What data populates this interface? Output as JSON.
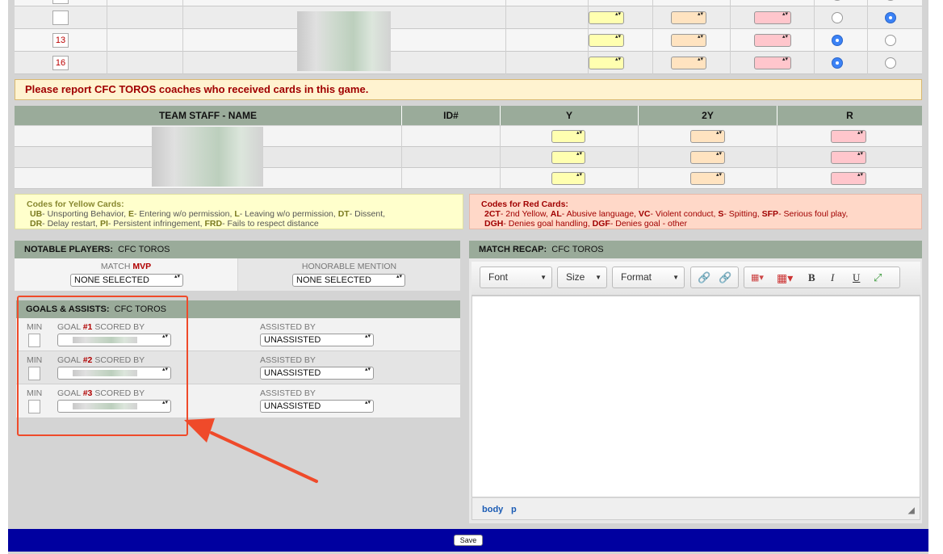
{
  "players": {
    "rows": [
      {
        "number": "",
        "y": "",
        "y2": "",
        "r": "",
        "radio_a": false,
        "radio_b": true
      },
      {
        "number": "13",
        "y": "",
        "y2": "",
        "r": "",
        "radio_a": true,
        "radio_b": false
      },
      {
        "number": "16",
        "y": "",
        "y2": "",
        "r": "",
        "radio_a": true,
        "radio_b": false
      }
    ]
  },
  "notice": {
    "text": "Please report CFC TOROS coaches who received cards in this game."
  },
  "staff": {
    "headers": {
      "name": "TEAM STAFF - NAME",
      "id": "ID#",
      "y": "Y",
      "y2": "2Y",
      "r": "R"
    },
    "rows": [
      {},
      {},
      {}
    ]
  },
  "yellow_codes": {
    "title": "Codes for Yellow Cards:",
    "line1": [
      {
        "code": "UB",
        "desc": "- Unsporting Behavior, "
      },
      {
        "code": "E",
        "desc": "- Entering w/o permission, "
      },
      {
        "code": "L",
        "desc": "- Leaving w/o permission, "
      },
      {
        "code": "DT",
        "desc": "- Dissent,"
      }
    ],
    "line2": [
      {
        "code": "DR",
        "desc": "- Delay restart, "
      },
      {
        "code": "PI",
        "desc": "- Persistent infringement, "
      },
      {
        "code": "FRD",
        "desc": "- Fails to respect distance"
      }
    ]
  },
  "red_codes": {
    "title": "Codes for Red Cards:",
    "line1": [
      {
        "code": "2CT",
        "desc": "- 2nd Yellow, "
      },
      {
        "code": "AL",
        "desc": "- Abusive language, "
      },
      {
        "code": "VC",
        "desc": "- Violent conduct, "
      },
      {
        "code": "S",
        "desc": "- Spitting, "
      },
      {
        "code": "SFP",
        "desc": "- Serious foul play,"
      }
    ],
    "line2": [
      {
        "code": "DGH",
        "desc": "- Denies goal handling, "
      },
      {
        "code": "DGF",
        "desc": "- Denies goal - other"
      }
    ]
  },
  "notable": {
    "label": "NOTABLE PLAYERS:",
    "team": "CFC TOROS",
    "mvp_prefix": "MATCH ",
    "mvp_word": "MVP",
    "mvp_value": "NONE SELECTED",
    "honorable_label": "HONORABLE MENTION",
    "honorable_value": "NONE SELECTED"
  },
  "goals": {
    "label": "GOALS & ASSISTS:",
    "team": "CFC TOROS",
    "rows": [
      {
        "min_label": "MIN",
        "goal_prefix": "GOAL ",
        "goal_num": "#1",
        "goal_suffix": " SCORED BY",
        "assist_label": "ASSISTED BY",
        "assist_value": "UNASSISTED"
      },
      {
        "min_label": "MIN",
        "goal_prefix": "GOAL ",
        "goal_num": "#2",
        "goal_suffix": " SCORED BY",
        "assist_label": "ASSISTED BY",
        "assist_value": "UNASSISTED"
      },
      {
        "min_label": "MIN",
        "goal_prefix": "GOAL ",
        "goal_num": "#3",
        "goal_suffix": " SCORED BY",
        "assist_label": "ASSISTED BY",
        "assist_value": "UNASSISTED"
      }
    ]
  },
  "recap": {
    "label": "MATCH RECAP:",
    "team": "CFC TOROS",
    "toolbar": {
      "font": "Font",
      "size": "Size",
      "format": "Format",
      "bold": "B",
      "italic": "I",
      "underline": "U"
    },
    "status": {
      "path1": "body",
      "path2": "p"
    }
  },
  "footer": {
    "save": "Save"
  },
  "colors": {
    "highlight": "#ef4a2a",
    "footer": "#0000a0",
    "header": "#9aab9a"
  }
}
